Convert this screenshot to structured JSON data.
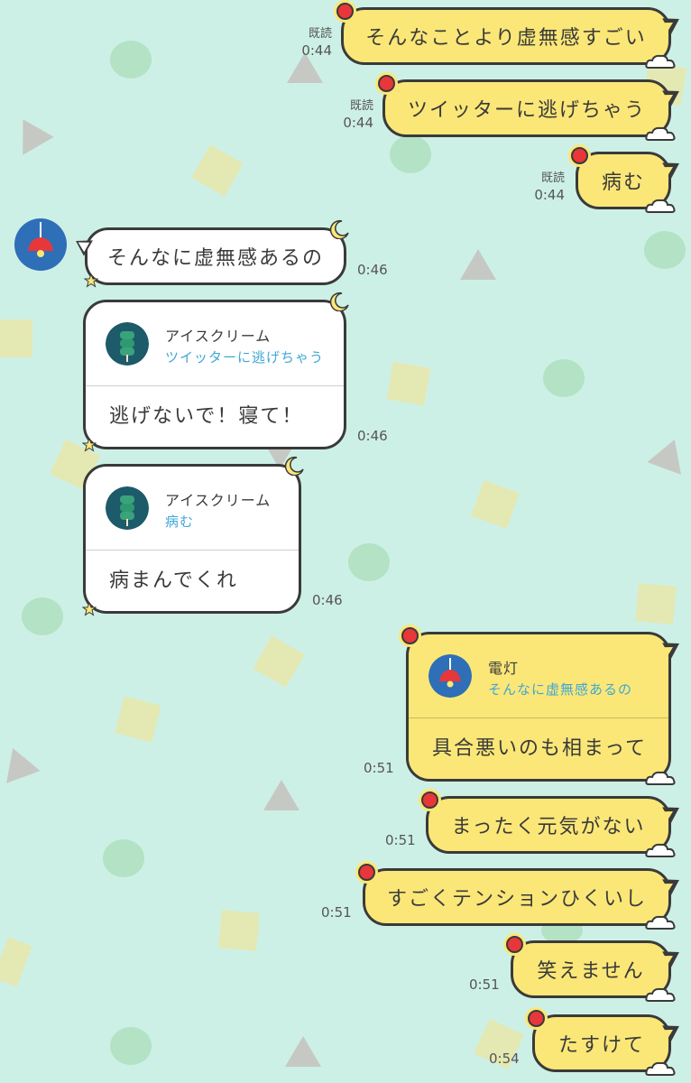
{
  "messages_out_top": [
    {
      "text": "そんなことより虚無感すごい",
      "read": "既読",
      "time": "0:44"
    },
    {
      "text": "ツイッターに逃げちゃう",
      "read": "既読",
      "time": "0:44"
    },
    {
      "text": "病む",
      "read": "既読",
      "time": "0:44"
    }
  ],
  "messages_in": [
    {
      "text": "そんなに虚無感あるの",
      "time": "0:46"
    },
    {
      "reply_name": "アイスクリーム",
      "reply_quote": "ツイッターに逃げちゃう",
      "text": "逃げないで！寝て！",
      "time": "0:46"
    },
    {
      "reply_name": "アイスクリーム",
      "reply_quote": "病む",
      "text": "病まんでくれ",
      "time": "0:46"
    }
  ],
  "messages_out_bottom": [
    {
      "reply_name": "電灯",
      "reply_quote": "そんなに虚無感あるの",
      "text": "具合悪いのも相まって",
      "time": "0:51"
    },
    {
      "text": "まったく元気がない",
      "time": "0:51"
    },
    {
      "text": "すごくテンションひくいし",
      "time": "0:51"
    },
    {
      "text": "笑えません",
      "time": "0:51"
    },
    {
      "text": "たすけて",
      "time": "0:54"
    }
  ],
  "icons": {
    "contact_avatar": "lamp-icon",
    "reply_avatar": "ice-cream-icon",
    "out_decoration": "sun-icon",
    "in_decoration": "moon-icon"
  },
  "colors": {
    "background": "#cdf0e6",
    "outgoing_bubble": "#fbe777",
    "incoming_bubble": "#ffffff",
    "quote_text": "#3fa7d6"
  }
}
